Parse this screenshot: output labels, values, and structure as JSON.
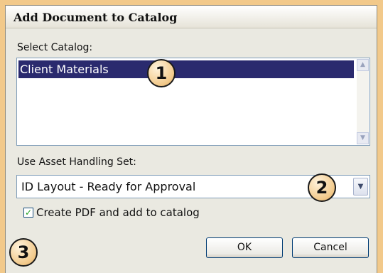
{
  "dialog": {
    "title": "Add Document to Catalog",
    "select_catalog_label": "Select Catalog:",
    "catalogs": [
      "Client Materials"
    ],
    "asset_handling_label": "Use Asset Handling Set:",
    "asset_handling_value": "ID Layout - Ready for Approval",
    "create_pdf_checked": true,
    "create_pdf_label": "Create PDF and add to catalog",
    "ok_label": "OK",
    "cancel_label": "Cancel"
  },
  "callouts": [
    "1",
    "2",
    "3"
  ],
  "icons": {
    "scroll_up": "chevron-up-icon",
    "scroll_down": "chevron-down-icon",
    "dropdown": "chevron-down-icon",
    "check": "checkmark-icon"
  },
  "colors": {
    "selection": "#2a2a6e",
    "backdrop": "#f2c98a",
    "dialog_bg": "#eae9e1"
  }
}
